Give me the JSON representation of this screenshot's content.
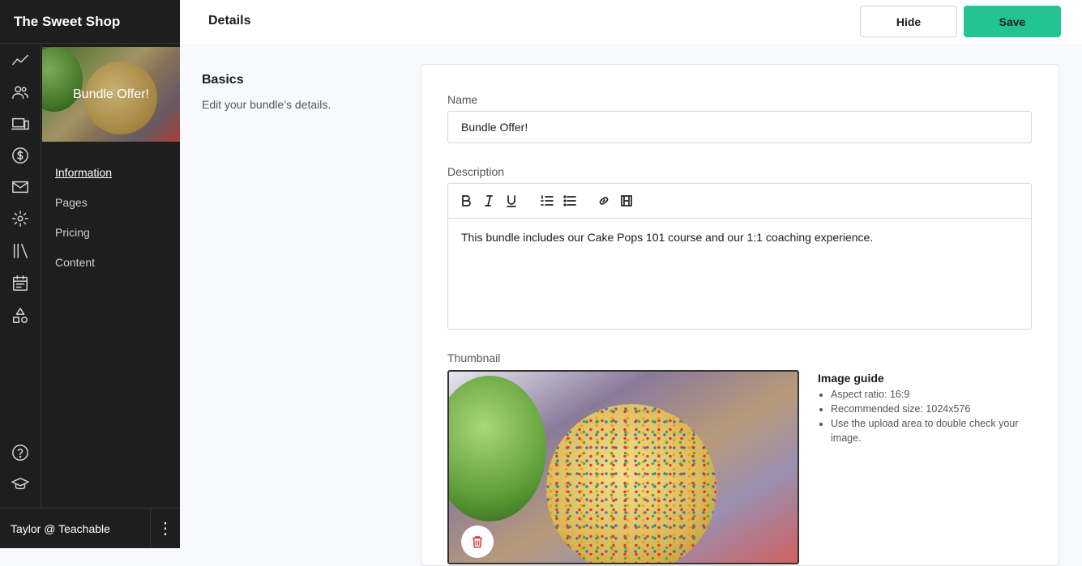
{
  "app": {
    "brand": "The Sweet Shop"
  },
  "header": {
    "title": "Details",
    "hide_label": "Hide",
    "save_label": "Save"
  },
  "sidebar": {
    "rail_icons": [
      "analytics-icon",
      "users-icon",
      "devices-icon",
      "dollar-icon",
      "mail-icon",
      "settings-icon",
      "library-icon",
      "calendar-icon",
      "shapes-icon",
      "help-icon",
      "graduation-cap-icon"
    ],
    "product_title": "Bundle Offer!",
    "subnav": [
      {
        "label": "Information",
        "active": true
      },
      {
        "label": "Pages"
      },
      {
        "label": "Pricing"
      },
      {
        "label": "Content"
      }
    ],
    "user": "Taylor @ Teachable"
  },
  "basics": {
    "heading": "Basics",
    "description": "Edit your bundle’s details."
  },
  "form": {
    "name_label": "Name",
    "name_value": "Bundle Offer!",
    "description_label": "Description",
    "description_value": "This bundle includes our Cake Pops 101 course and our 1:1 coaching experience.",
    "thumbnail_label": "Thumbnail"
  },
  "image_guide": {
    "heading": "Image guide",
    "items": [
      "Aspect ratio: 16:9",
      "Recommended size: 1024x576",
      "Use the upload area to double check your image."
    ]
  },
  "colors": {
    "accent": "#22c493",
    "sidebar": "#1e1e1e",
    "delete": "#d83a3a"
  }
}
